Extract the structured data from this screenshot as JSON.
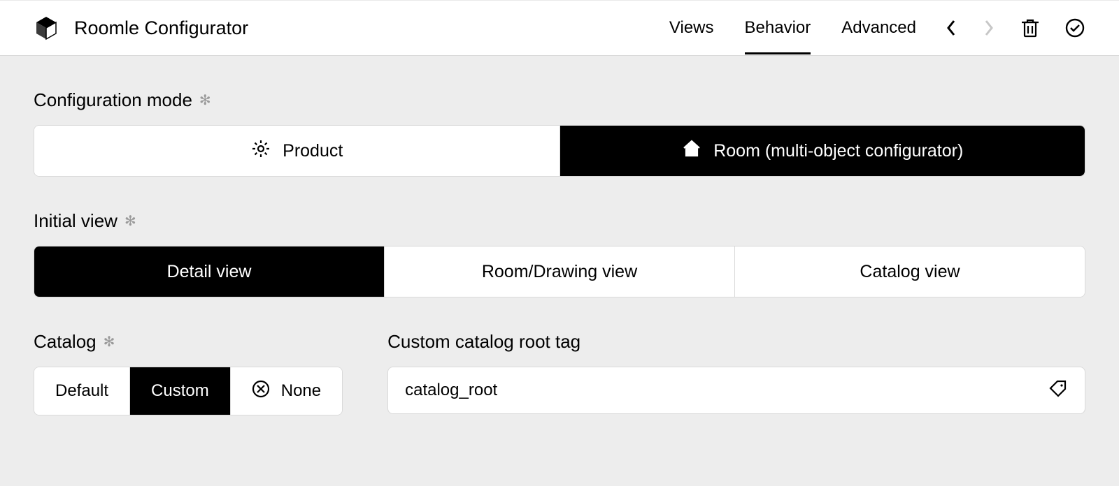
{
  "header": {
    "title": "Roomle Configurator",
    "tabs": [
      {
        "label": "Views",
        "active": false
      },
      {
        "label": "Behavior",
        "active": true
      },
      {
        "label": "Advanced",
        "active": false
      }
    ]
  },
  "sections": {
    "config_mode": {
      "label": "Configuration mode",
      "options": [
        "Product",
        "Room (multi-object configurator)"
      ],
      "selected": 1
    },
    "initial_view": {
      "label": "Initial view",
      "options": [
        "Detail view",
        "Room/Drawing view",
        "Catalog view"
      ],
      "selected": 0
    },
    "catalog": {
      "label": "Catalog",
      "options": [
        "Default",
        "Custom",
        "None"
      ],
      "selected": 1
    },
    "root_tag": {
      "label": "Custom catalog root tag",
      "value": "catalog_root"
    }
  }
}
